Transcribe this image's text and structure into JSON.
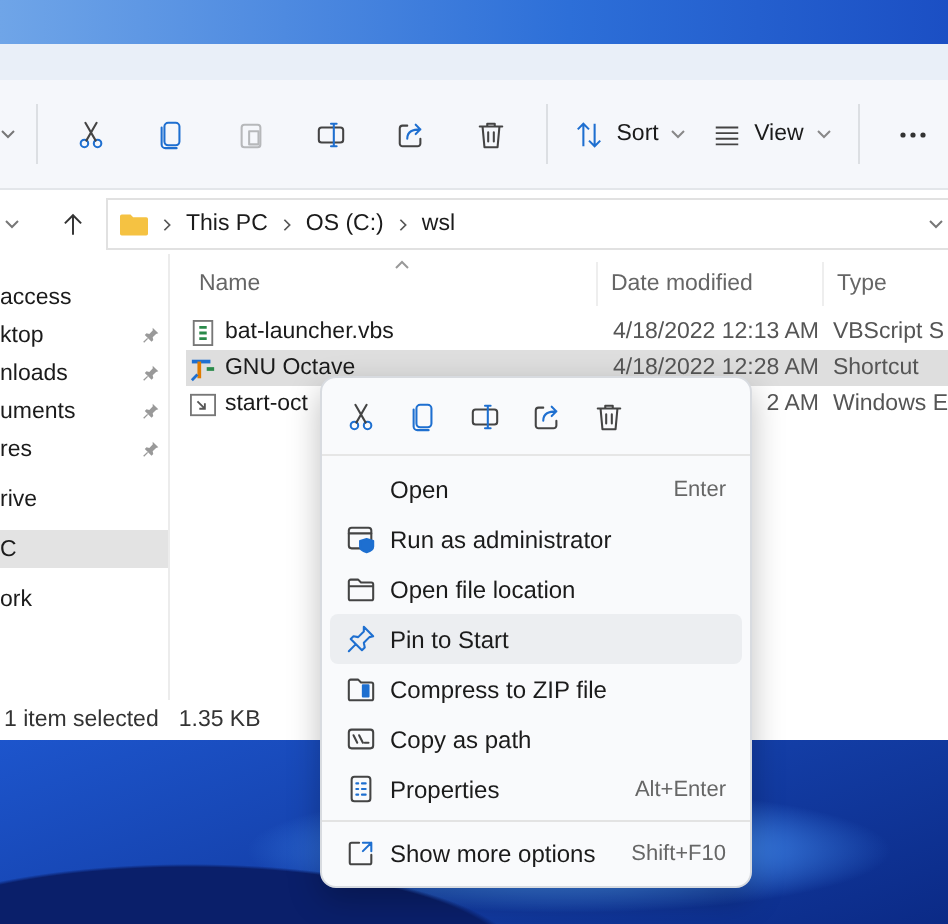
{
  "toolbar": {
    "icon_buttons": [
      {
        "kind": "cut",
        "disabled": false
      },
      {
        "kind": "copy",
        "disabled": false
      },
      {
        "kind": "paste",
        "disabled": true
      },
      {
        "kind": "rename",
        "disabled": false
      },
      {
        "kind": "share",
        "disabled": false
      },
      {
        "kind": "delete",
        "disabled": false
      }
    ],
    "sort": "Sort",
    "view": "View"
  },
  "address": {
    "path": [
      "This PC",
      "OS (C:)",
      "wsl"
    ]
  },
  "sidebar": {
    "sections": [
      {
        "items": [
          {
            "label": "access",
            "pinned": false,
            "selected": false
          },
          {
            "label": "ktop",
            "pinned": true,
            "selected": false
          },
          {
            "label": "nloads",
            "pinned": true,
            "selected": false
          },
          {
            "label": "uments",
            "pinned": true,
            "selected": false
          },
          {
            "label": "res",
            "pinned": true,
            "selected": false
          }
        ]
      },
      {
        "items": [
          {
            "label": "rive",
            "pinned": false,
            "selected": false
          }
        ]
      },
      {
        "items": [
          {
            "label": "C",
            "pinned": false,
            "selected": true
          }
        ]
      },
      {
        "items": [
          {
            "label": "ork",
            "pinned": false,
            "selected": false
          }
        ]
      }
    ]
  },
  "table": {
    "columns": [
      "Name",
      "Date modified",
      "Type"
    ],
    "rows": [
      {
        "kind": "script",
        "name": "bat-launcher.vbs",
        "date": "4/18/2022 12:13 AM",
        "type": "VBScript S",
        "selected": false
      },
      {
        "kind": "app",
        "name": "GNU Octave",
        "date": "4/18/2022 12:28 AM",
        "type": "Shortcut",
        "selected": true
      },
      {
        "kind": "link",
        "name": "start-oct",
        "date": "2 AM",
        "type": "Windows E",
        "selected": false
      }
    ]
  },
  "status_bar": {
    "count": "1 item selected",
    "size": "1.35 KB"
  },
  "context_menu": {
    "actions": [
      {
        "kind": "cut"
      },
      {
        "kind": "copy"
      },
      {
        "kind": "rename"
      },
      {
        "kind": "share"
      },
      {
        "kind": "delete"
      }
    ],
    "items": [
      {
        "kind": "none",
        "label": "Open",
        "shortcut": "Enter",
        "selected": false
      },
      {
        "kind": "admin",
        "label": "Run as administrator",
        "selected": false
      },
      {
        "kind": "folder",
        "label": "Open file location",
        "selected": false
      },
      {
        "kind": "pin",
        "label": "Pin to Start",
        "selected": true
      },
      {
        "kind": "zip",
        "label": "Compress to ZIP file",
        "selected": false
      },
      {
        "kind": "path",
        "label": "Copy as path",
        "selected": false
      },
      {
        "kind": "properties",
        "label": "Properties",
        "shortcut": "Alt+Enter",
        "selected": false
      }
    ],
    "more": {
      "label": "Show more options",
      "shortcut": "Shift+F10"
    }
  }
}
